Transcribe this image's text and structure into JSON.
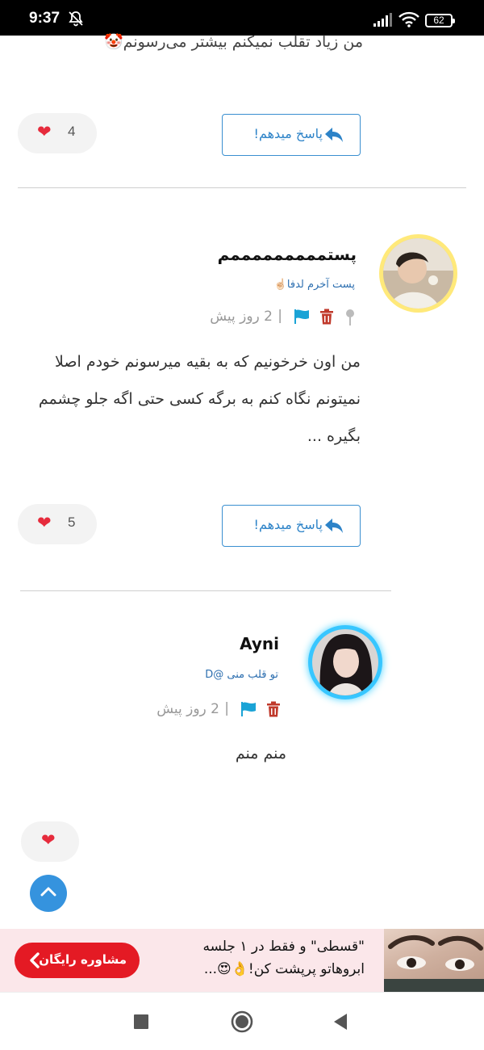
{
  "status_bar": {
    "time": "9:37",
    "battery": "62"
  },
  "top_post": {
    "text_fragment": "من زیاد تقلب نمیکنم بیشتر می‌رسونم🤡",
    "likes": "4",
    "reply_label": "پاسخ میدهم!"
  },
  "post_1": {
    "username": "پستمممممممممم",
    "subtitle": "پست آخرم لدفا☝🏻",
    "time_ago": "2 روز پیش",
    "body": "من اون خرخونیم که به بقیه میرسونم خودم اصلا نمیتونم نگاه کنم به برگه کسی حتی اگه جلو چشمم بگیره ...",
    "likes": "5",
    "reply_label": "پاسخ میدهم!"
  },
  "post_2": {
    "username": "Ayni",
    "subtitle": "تو قلب منی @D",
    "time_ago": "2 روز پیش",
    "body": "منم منم",
    "likes": ""
  },
  "ad": {
    "line1": "\"قسطی\" و فقط در ۱ جلسه",
    "line2": "ابروهاتو پرپشت کن!👌😍...",
    "button_label": "مشاوره رایگان"
  },
  "colors": {
    "accent": "#2d83c8",
    "heart": "#e62b3c",
    "ad_button": "#e41a24",
    "scroll_button": "#3593de"
  },
  "icons": [
    "mute-bell-icon",
    "signal-icon",
    "wifi-icon",
    "battery-icon",
    "heart-icon",
    "reply-arrow-icon",
    "pin-icon",
    "trash-icon",
    "flag-icon",
    "chevron-up-icon",
    "chevron-left-icon",
    "nav-square-icon",
    "nav-home-icon",
    "nav-back-icon"
  ]
}
